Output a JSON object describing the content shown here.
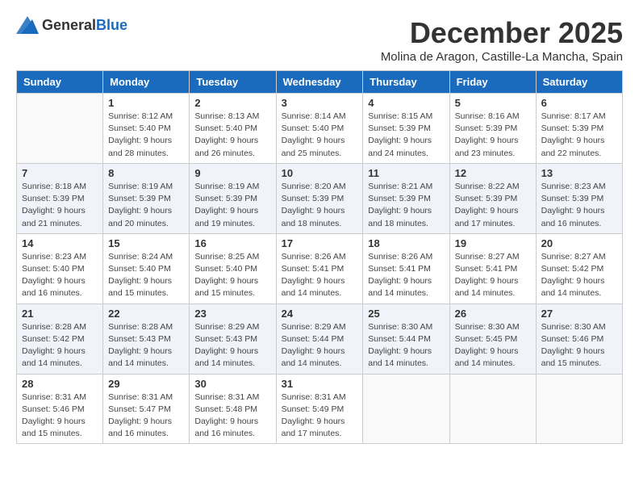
{
  "logo": {
    "general": "General",
    "blue": "Blue"
  },
  "title": "December 2025",
  "location": "Molina de Aragon, Castille-La Mancha, Spain",
  "days_of_week": [
    "Sunday",
    "Monday",
    "Tuesday",
    "Wednesday",
    "Thursday",
    "Friday",
    "Saturday"
  ],
  "weeks": [
    [
      {
        "day": "",
        "sunrise": "",
        "sunset": "",
        "daylight": ""
      },
      {
        "day": "1",
        "sunrise": "Sunrise: 8:12 AM",
        "sunset": "Sunset: 5:40 PM",
        "daylight": "Daylight: 9 hours and 28 minutes."
      },
      {
        "day": "2",
        "sunrise": "Sunrise: 8:13 AM",
        "sunset": "Sunset: 5:40 PM",
        "daylight": "Daylight: 9 hours and 26 minutes."
      },
      {
        "day": "3",
        "sunrise": "Sunrise: 8:14 AM",
        "sunset": "Sunset: 5:40 PM",
        "daylight": "Daylight: 9 hours and 25 minutes."
      },
      {
        "day": "4",
        "sunrise": "Sunrise: 8:15 AM",
        "sunset": "Sunset: 5:39 PM",
        "daylight": "Daylight: 9 hours and 24 minutes."
      },
      {
        "day": "5",
        "sunrise": "Sunrise: 8:16 AM",
        "sunset": "Sunset: 5:39 PM",
        "daylight": "Daylight: 9 hours and 23 minutes."
      },
      {
        "day": "6",
        "sunrise": "Sunrise: 8:17 AM",
        "sunset": "Sunset: 5:39 PM",
        "daylight": "Daylight: 9 hours and 22 minutes."
      }
    ],
    [
      {
        "day": "7",
        "sunrise": "Sunrise: 8:18 AM",
        "sunset": "Sunset: 5:39 PM",
        "daylight": "Daylight: 9 hours and 21 minutes."
      },
      {
        "day": "8",
        "sunrise": "Sunrise: 8:19 AM",
        "sunset": "Sunset: 5:39 PM",
        "daylight": "Daylight: 9 hours and 20 minutes."
      },
      {
        "day": "9",
        "sunrise": "Sunrise: 8:19 AM",
        "sunset": "Sunset: 5:39 PM",
        "daylight": "Daylight: 9 hours and 19 minutes."
      },
      {
        "day": "10",
        "sunrise": "Sunrise: 8:20 AM",
        "sunset": "Sunset: 5:39 PM",
        "daylight": "Daylight: 9 hours and 18 minutes."
      },
      {
        "day": "11",
        "sunrise": "Sunrise: 8:21 AM",
        "sunset": "Sunset: 5:39 PM",
        "daylight": "Daylight: 9 hours and 18 minutes."
      },
      {
        "day": "12",
        "sunrise": "Sunrise: 8:22 AM",
        "sunset": "Sunset: 5:39 PM",
        "daylight": "Daylight: 9 hours and 17 minutes."
      },
      {
        "day": "13",
        "sunrise": "Sunrise: 8:23 AM",
        "sunset": "Sunset: 5:39 PM",
        "daylight": "Daylight: 9 hours and 16 minutes."
      }
    ],
    [
      {
        "day": "14",
        "sunrise": "Sunrise: 8:23 AM",
        "sunset": "Sunset: 5:40 PM",
        "daylight": "Daylight: 9 hours and 16 minutes."
      },
      {
        "day": "15",
        "sunrise": "Sunrise: 8:24 AM",
        "sunset": "Sunset: 5:40 PM",
        "daylight": "Daylight: 9 hours and 15 minutes."
      },
      {
        "day": "16",
        "sunrise": "Sunrise: 8:25 AM",
        "sunset": "Sunset: 5:40 PM",
        "daylight": "Daylight: 9 hours and 15 minutes."
      },
      {
        "day": "17",
        "sunrise": "Sunrise: 8:26 AM",
        "sunset": "Sunset: 5:41 PM",
        "daylight": "Daylight: 9 hours and 14 minutes."
      },
      {
        "day": "18",
        "sunrise": "Sunrise: 8:26 AM",
        "sunset": "Sunset: 5:41 PM",
        "daylight": "Daylight: 9 hours and 14 minutes."
      },
      {
        "day": "19",
        "sunrise": "Sunrise: 8:27 AM",
        "sunset": "Sunset: 5:41 PM",
        "daylight": "Daylight: 9 hours and 14 minutes."
      },
      {
        "day": "20",
        "sunrise": "Sunrise: 8:27 AM",
        "sunset": "Sunset: 5:42 PM",
        "daylight": "Daylight: 9 hours and 14 minutes."
      }
    ],
    [
      {
        "day": "21",
        "sunrise": "Sunrise: 8:28 AM",
        "sunset": "Sunset: 5:42 PM",
        "daylight": "Daylight: 9 hours and 14 minutes."
      },
      {
        "day": "22",
        "sunrise": "Sunrise: 8:28 AM",
        "sunset": "Sunset: 5:43 PM",
        "daylight": "Daylight: 9 hours and 14 minutes."
      },
      {
        "day": "23",
        "sunrise": "Sunrise: 8:29 AM",
        "sunset": "Sunset: 5:43 PM",
        "daylight": "Daylight: 9 hours and 14 minutes."
      },
      {
        "day": "24",
        "sunrise": "Sunrise: 8:29 AM",
        "sunset": "Sunset: 5:44 PM",
        "daylight": "Daylight: 9 hours and 14 minutes."
      },
      {
        "day": "25",
        "sunrise": "Sunrise: 8:30 AM",
        "sunset": "Sunset: 5:44 PM",
        "daylight": "Daylight: 9 hours and 14 minutes."
      },
      {
        "day": "26",
        "sunrise": "Sunrise: 8:30 AM",
        "sunset": "Sunset: 5:45 PM",
        "daylight": "Daylight: 9 hours and 14 minutes."
      },
      {
        "day": "27",
        "sunrise": "Sunrise: 8:30 AM",
        "sunset": "Sunset: 5:46 PM",
        "daylight": "Daylight: 9 hours and 15 minutes."
      }
    ],
    [
      {
        "day": "28",
        "sunrise": "Sunrise: 8:31 AM",
        "sunset": "Sunset: 5:46 PM",
        "daylight": "Daylight: 9 hours and 15 minutes."
      },
      {
        "day": "29",
        "sunrise": "Sunrise: 8:31 AM",
        "sunset": "Sunset: 5:47 PM",
        "daylight": "Daylight: 9 hours and 16 minutes."
      },
      {
        "day": "30",
        "sunrise": "Sunrise: 8:31 AM",
        "sunset": "Sunset: 5:48 PM",
        "daylight": "Daylight: 9 hours and 16 minutes."
      },
      {
        "day": "31",
        "sunrise": "Sunrise: 8:31 AM",
        "sunset": "Sunset: 5:49 PM",
        "daylight": "Daylight: 9 hours and 17 minutes."
      },
      {
        "day": "",
        "sunrise": "",
        "sunset": "",
        "daylight": ""
      },
      {
        "day": "",
        "sunrise": "",
        "sunset": "",
        "daylight": ""
      },
      {
        "day": "",
        "sunrise": "",
        "sunset": "",
        "daylight": ""
      }
    ]
  ]
}
